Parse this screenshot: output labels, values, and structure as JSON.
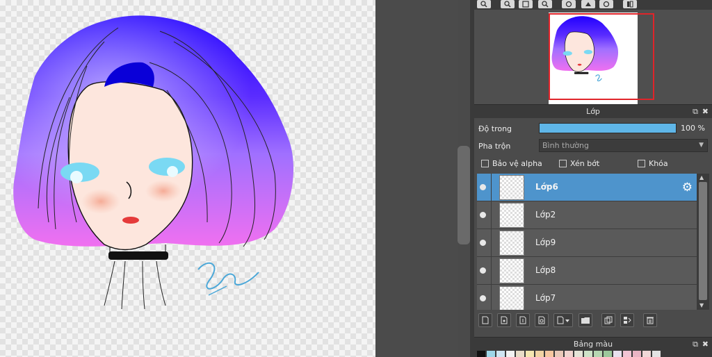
{
  "layer_panel": {
    "title": "Lớp",
    "opacity_label": "Độ trong",
    "opacity_value": "100 %",
    "opacity_fraction": 1.0,
    "blend_label": "Pha trộn",
    "blend_value": "Bình thường",
    "checkboxes": [
      {
        "label": "Bảo vệ alpha",
        "checked": false
      },
      {
        "label": "Xén bớt",
        "checked": false
      },
      {
        "label": "Khóa",
        "checked": false
      }
    ],
    "layers": [
      {
        "name": "Lớp6",
        "selected": true
      },
      {
        "name": "Lớp2",
        "selected": false
      },
      {
        "name": "Lớp9",
        "selected": false
      },
      {
        "name": "Lớp8",
        "selected": false
      },
      {
        "name": "Lớp7",
        "selected": false
      }
    ]
  },
  "palette_panel": {
    "title": "Bảng màu",
    "colors": [
      "#111111",
      "#9ed6e8",
      "#cfe5f2",
      "#f2f2f2",
      "#e8dcc7",
      "#f4e6b0",
      "#f1d3a3",
      "#f6c7a0",
      "#e9c9b9",
      "#f1d4cf",
      "#e5e4d7",
      "#cfe3c8",
      "#b7d7b2",
      "#9cc79b",
      "#e8e0ee",
      "#f2c4d4",
      "#eab4c4",
      "#f0d7d7",
      "#e3e3e3"
    ]
  },
  "colors": {
    "accent": "#4e94cc",
    "opacity_fill": "#5fb6e8",
    "nav_frame": "#e0242a"
  }
}
